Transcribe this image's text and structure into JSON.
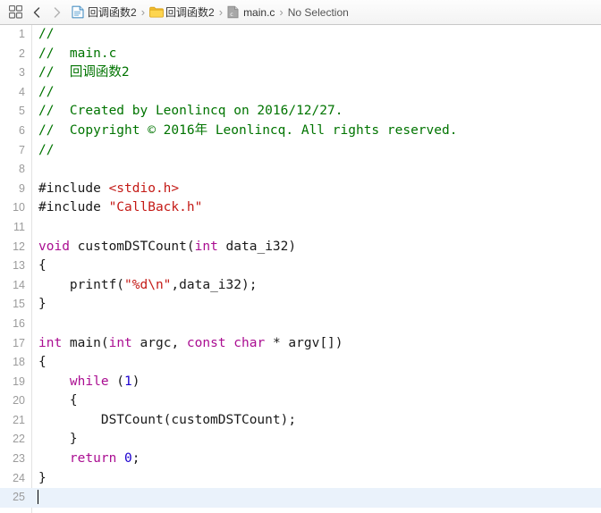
{
  "jump_bar": {
    "panel_toggle_icon": "grid-squares-icon",
    "back_icon": "chevron-left-icon",
    "forward_icon": "chevron-right-icon",
    "separator": "›",
    "breadcrumbs": [
      {
        "icon": "project-document-icon",
        "label": "回调函数2"
      },
      {
        "icon": "folder-icon",
        "label": "回调函数2"
      },
      {
        "icon": "c-source-file-icon",
        "label": "main.c"
      },
      {
        "icon": "none",
        "label": "No Selection"
      }
    ]
  },
  "colors": {
    "comment": "#007400",
    "keyword": "#aa0d91",
    "string": "#c41a16",
    "number": "#1c00cf",
    "plain": "#1a1a1a",
    "current_line": "#eaf2fb",
    "gutter_text": "#9b9b9b"
  },
  "editor": {
    "current_line_number": 25,
    "lines": [
      {
        "n": 1,
        "tokens": [
          {
            "t": "comment",
            "v": "//"
          }
        ]
      },
      {
        "n": 2,
        "tokens": [
          {
            "t": "comment",
            "v": "//  main.c"
          }
        ]
      },
      {
        "n": 3,
        "tokens": [
          {
            "t": "comment",
            "v": "//  回调函数2"
          }
        ]
      },
      {
        "n": 4,
        "tokens": [
          {
            "t": "comment",
            "v": "//"
          }
        ]
      },
      {
        "n": 5,
        "tokens": [
          {
            "t": "comment",
            "v": "//  Created by Leonlincq on 2016/12/27."
          }
        ]
      },
      {
        "n": 6,
        "tokens": [
          {
            "t": "comment",
            "v": "//  Copyright © 2016年 Leonlincq. All rights reserved."
          }
        ]
      },
      {
        "n": 7,
        "tokens": [
          {
            "t": "comment",
            "v": "//"
          }
        ]
      },
      {
        "n": 8,
        "tokens": []
      },
      {
        "n": 9,
        "tokens": [
          {
            "t": "pre",
            "v": "#include "
          },
          {
            "t": "string",
            "v": "<stdio.h>"
          }
        ]
      },
      {
        "n": 10,
        "tokens": [
          {
            "t": "pre",
            "v": "#include "
          },
          {
            "t": "string",
            "v": "\"CallBack.h\""
          }
        ]
      },
      {
        "n": 11,
        "tokens": []
      },
      {
        "n": 12,
        "tokens": [
          {
            "t": "keyword",
            "v": "void"
          },
          {
            "t": "plain",
            "v": " customDSTCount("
          },
          {
            "t": "keyword",
            "v": "int"
          },
          {
            "t": "plain",
            "v": " data_i32)"
          }
        ]
      },
      {
        "n": 13,
        "tokens": [
          {
            "t": "plain",
            "v": "{"
          }
        ]
      },
      {
        "n": 14,
        "tokens": [
          {
            "t": "plain",
            "v": "    printf("
          },
          {
            "t": "string",
            "v": "\"%d\\n\""
          },
          {
            "t": "plain",
            "v": ",data_i32);"
          }
        ]
      },
      {
        "n": 15,
        "tokens": [
          {
            "t": "plain",
            "v": "}"
          }
        ]
      },
      {
        "n": 16,
        "tokens": []
      },
      {
        "n": 17,
        "tokens": [
          {
            "t": "keyword",
            "v": "int"
          },
          {
            "t": "plain",
            "v": " main("
          },
          {
            "t": "keyword",
            "v": "int"
          },
          {
            "t": "plain",
            "v": " argc, "
          },
          {
            "t": "keyword",
            "v": "const"
          },
          {
            "t": "plain",
            "v": " "
          },
          {
            "t": "keyword",
            "v": "char"
          },
          {
            "t": "plain",
            "v": " * argv[])"
          }
        ]
      },
      {
        "n": 18,
        "tokens": [
          {
            "t": "plain",
            "v": "{"
          }
        ]
      },
      {
        "n": 19,
        "tokens": [
          {
            "t": "plain",
            "v": "    "
          },
          {
            "t": "keyword",
            "v": "while"
          },
          {
            "t": "plain",
            "v": " ("
          },
          {
            "t": "number",
            "v": "1"
          },
          {
            "t": "plain",
            "v": ")"
          }
        ]
      },
      {
        "n": 20,
        "tokens": [
          {
            "t": "plain",
            "v": "    {"
          }
        ]
      },
      {
        "n": 21,
        "tokens": [
          {
            "t": "plain",
            "v": "        DSTCount(customDSTCount);"
          }
        ]
      },
      {
        "n": 22,
        "tokens": [
          {
            "t": "plain",
            "v": "    }"
          }
        ]
      },
      {
        "n": 23,
        "tokens": [
          {
            "t": "plain",
            "v": "    "
          },
          {
            "t": "keyword",
            "v": "return"
          },
          {
            "t": "plain",
            "v": " "
          },
          {
            "t": "number",
            "v": "0"
          },
          {
            "t": "plain",
            "v": ";"
          }
        ]
      },
      {
        "n": 24,
        "tokens": [
          {
            "t": "plain",
            "v": "}"
          }
        ]
      },
      {
        "n": 25,
        "tokens": []
      }
    ]
  }
}
